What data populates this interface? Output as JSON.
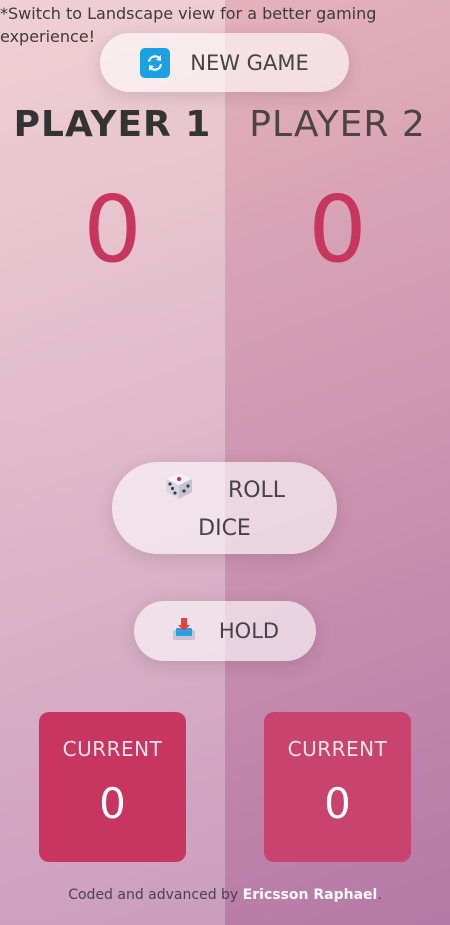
{
  "notice": "*Switch to Landscape view for a better gaming experience!",
  "buttons": {
    "new_game": "NEW GAME",
    "roll_line1": "ROLL",
    "roll_line2": "DICE",
    "hold": "HOLD"
  },
  "players": [
    {
      "name": "PLAYER 1",
      "score": "0",
      "current_label": "CURRENT",
      "current": "0"
    },
    {
      "name": "PLAYER 2",
      "score": "0",
      "current_label": "CURRENT",
      "current": "0"
    }
  ],
  "footer": {
    "text": "Coded and advanced by",
    "author": "Ericsson Raphael",
    "end": "."
  },
  "colors": {
    "accent": "#c7375d",
    "icon_blue": "#1aa1e3"
  }
}
